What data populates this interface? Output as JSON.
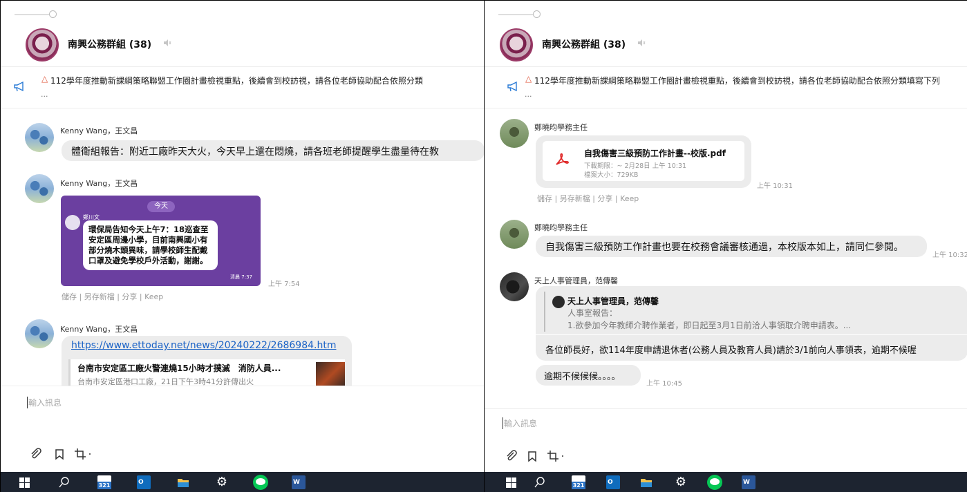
{
  "left": {
    "group": {
      "name": "南興公務群組 (38)"
    },
    "announcement": {
      "text": "112學年度推動新課綱策略聯盟工作圈計畫檢視重點，後續會到校訪視，請各位老師協助配合依照分類",
      "more": "..."
    },
    "messages": [
      {
        "sender": "Kenny Wang，王文昌",
        "text": "體衛組報告：附近工廠昨天大火，今天早上還在悶燒，請各班老師提醒學生盡量待在教"
      },
      {
        "sender": "Kenny Wang，王文昌",
        "image": {
          "day": "今天",
          "forward_sender": "鄭川文",
          "forward_text": "環保局告知今天上午7：18巡查至安定區周邊小學，目前南興國小有部分燒木頭異味，請學校師生配戴口罩及避免學校戶外活動，謝謝。",
          "forward_time": "清晨 7:37"
        },
        "time": "上午 7:54",
        "actions": "儲存 | 另存新檔 | 分享 | Keep"
      },
      {
        "sender": "Kenny Wang，王文昌",
        "link": "https://www.ettoday.net/news/20240222/2686984.htm",
        "preview_title": "台南市安定區工廠火警連燒15小時才撲滅　消防人員...",
        "preview_desc": "台南市安定區港口工廠，21日下午3時41分許傳出火"
      }
    ],
    "input_placeholder": "輸入訊息"
  },
  "right": {
    "group": {
      "name": "南興公務群組 (38)"
    },
    "announcement": {
      "text": "112學年度推動新課綱策略聯盟工作圈計畫檢視重點，後續會到校訪視，請各位老師協助配合依照分類填寫下列",
      "more": "..."
    },
    "messages": [
      {
        "sender": "鄭曉昀學務主任",
        "file": {
          "name": "自我傷害三級預防工作計畫--校版.pdf",
          "expiry": "下載期限：~ 2月28日 上午 10:31",
          "size": "檔案大小：729KB"
        },
        "time": "上午 10:31",
        "actions": "儲存 | 另存新檔 | 分享 | Keep"
      },
      {
        "sender": "鄭曉昀學務主任",
        "text": "自我傷害三級預防工作計畫也要在校務會議審核通過，本校版本如上，請同仁參閱。",
        "time": "上午 10:32"
      },
      {
        "sender": "天上人事管理員，范傳馨",
        "quote": {
          "name": "天上人事管理員，范傳馨",
          "line1": "人事室報告：",
          "line2": "1.欲參加今年教師介聘作業者，即日起至3月1日前洽人事領取介聘申請表。..."
        },
        "text": "各位師長好，欲114年度申請退休者(公務人員及教育人員)請於3/1前向人事領表，逾期不候喔"
      },
      {
        "text": "逾期不候候候。。。。",
        "time": "上午 10:45"
      }
    ],
    "input_placeholder": "輸入訊息"
  },
  "taskbar": {
    "calendar_day": "321"
  },
  "colors": {
    "bubble": "#ececec",
    "link": "#1a62c6",
    "image_bg": "#6b3fa0",
    "taskbar": "#1d2430",
    "line_green": "#06c755"
  },
  "icons": [
    "handle-icon",
    "mute-icon",
    "megaphone-icon",
    "fire-icon",
    "pdf-icon",
    "paperclip-icon",
    "bookmark-icon",
    "crop-icon",
    "windows-start-icon",
    "search-icon",
    "calendar-icon",
    "outlook-icon",
    "file-explorer-icon",
    "settings-icon",
    "line-app-icon",
    "word-icon"
  ]
}
